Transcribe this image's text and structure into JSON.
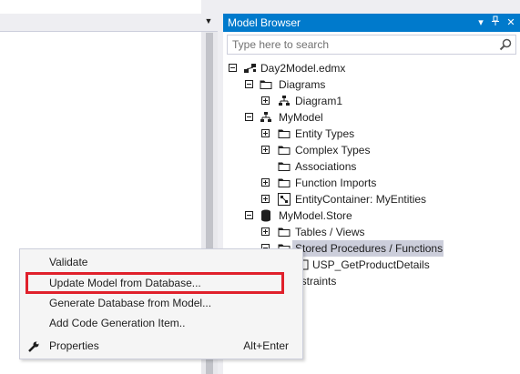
{
  "editor": {
    "dropdown_icon": "chevron-down-icon"
  },
  "model_browser": {
    "title": "Model Browser",
    "title_buttons": [
      "dropdown-icon",
      "pin-icon",
      "close-icon"
    ],
    "search_placeholder": "Type here to search",
    "accent_color": "#007acc"
  },
  "tree": [
    {
      "label": "Day2Model.edmx",
      "icon": "edmx-icon",
      "expander": "minus"
    },
    {
      "label": "Diagrams",
      "icon": "folder-icon",
      "expander": "minus"
    },
    {
      "label": "Diagram1",
      "icon": "diagram-icon",
      "expander": "plus"
    },
    {
      "label": "MyModel",
      "icon": "model-icon",
      "expander": "minus"
    },
    {
      "label": "Entity Types",
      "icon": "folder-icon",
      "expander": "plus"
    },
    {
      "label": "Complex Types",
      "icon": "folder-icon",
      "expander": "plus"
    },
    {
      "label": "Associations",
      "icon": "folder-icon",
      "expander": "none"
    },
    {
      "label": "Function Imports",
      "icon": "folder-icon",
      "expander": "plus"
    },
    {
      "label": "EntityContainer: MyEntities",
      "icon": "entity-container-icon",
      "expander": "plus"
    },
    {
      "label": "MyModel.Store",
      "icon": "database-icon",
      "expander": "minus"
    },
    {
      "label": "Tables / Views",
      "icon": "folder-icon",
      "expander": "plus"
    },
    {
      "label": "Stored Procedures / Functions",
      "icon": "folder-icon",
      "expander": "minus",
      "selected": true
    },
    {
      "label": "USP_GetProductDetails",
      "icon": "stored-procedure-icon",
      "expander": "none"
    },
    {
      "label": "nstraints",
      "icon": "folder-icon",
      "expander": "none"
    }
  ],
  "context_menu": {
    "items": [
      {
        "label": "Validate",
        "shortcut": ""
      },
      {
        "label": "Update Model from Database...",
        "shortcut": "",
        "highlighted": true
      },
      {
        "label": "Generate Database from Model...",
        "shortcut": ""
      },
      {
        "label": "Add Code Generation Item..",
        "shortcut": ""
      },
      {
        "label": "Properties",
        "shortcut": "Alt+Enter",
        "icon": "wrench-icon"
      }
    ],
    "highlight_color": "#e0202b"
  }
}
